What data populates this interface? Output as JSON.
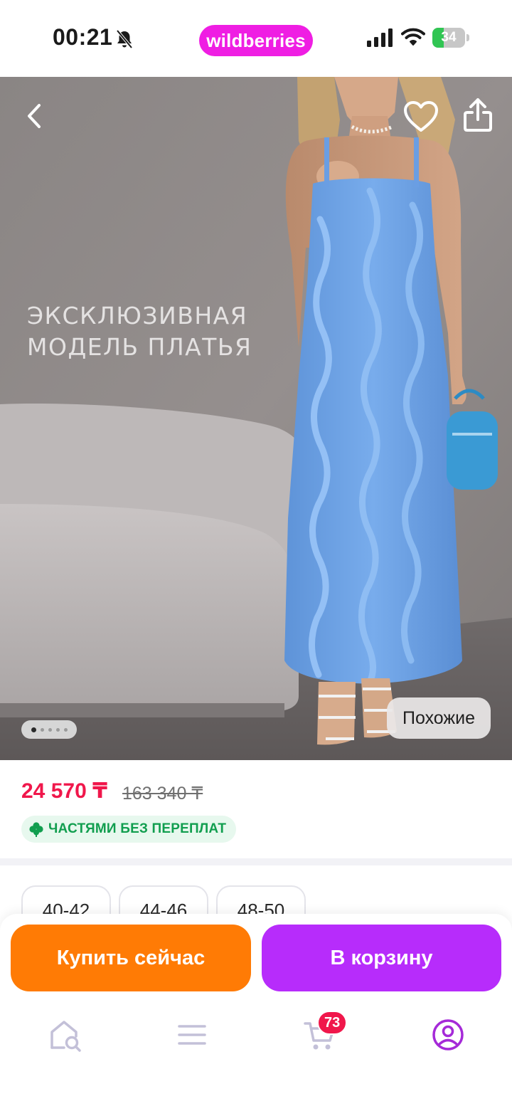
{
  "status_bar": {
    "time": "00:21",
    "brand": "wildberries",
    "battery_level": 34,
    "battery_text": "34",
    "icons": [
      "bell-muted-icon",
      "cellular-signal-icon",
      "wifi-icon",
      "battery-icon"
    ]
  },
  "hero": {
    "overlay_line1": "ЭКСКЛЮЗИВНАЯ",
    "overlay_line2": "МОДЕЛЬ ПЛАТЬЯ",
    "similar_label": "Похожие",
    "gallery_dots": 5,
    "gallery_active_index": 0,
    "icons": [
      "chevron-left-icon",
      "heart-icon",
      "share-icon"
    ]
  },
  "price": {
    "current": "24 570 ₸",
    "old": "163 340 ₸",
    "installment": "ЧАСТЯМИ БЕЗ ПЕРЕПЛАТ"
  },
  "sizes": [
    "40-42",
    "44-46",
    "48-50"
  ],
  "actions": {
    "buy_now": "Купить сейчас",
    "add_to_cart": "В корзину"
  },
  "tab_bar": {
    "cart_count": "73",
    "icons": [
      "home-search-icon",
      "menu-icon",
      "cart-icon",
      "profile-icon"
    ]
  },
  "colors": {
    "brand": "#ef1ee3",
    "price": "#f0174b",
    "installment": "#119e4f",
    "buy_button": "#ff7b05",
    "cart_button": "#b72cfb",
    "active_tab": "#a52ad8",
    "inactive_tab": "#c3c0d8"
  }
}
